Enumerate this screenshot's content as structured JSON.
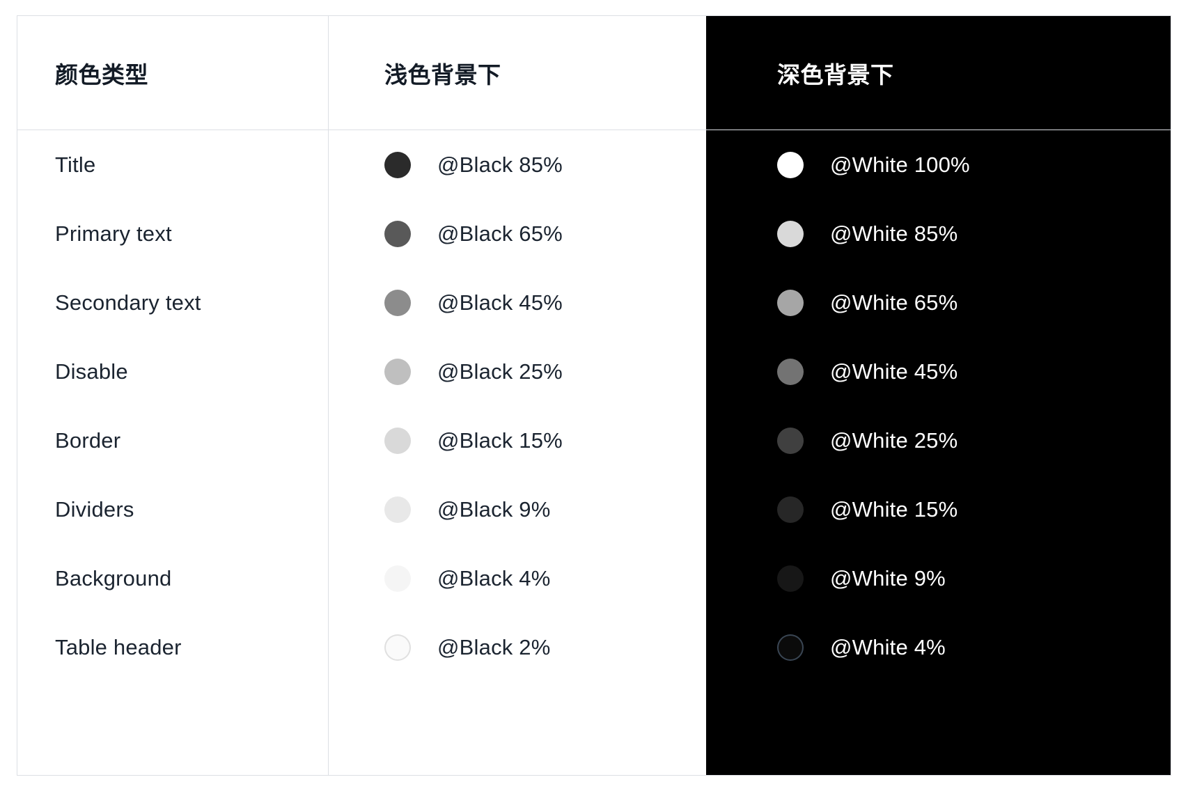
{
  "table": {
    "headers": [
      {
        "label": "颜色类型"
      },
      {
        "label": "浅色背景下"
      },
      {
        "label": "深色背景下"
      }
    ],
    "rows": [
      {
        "name": "Title",
        "light": {
          "token": "@Black 85%",
          "color": "#2b2b2b",
          "ring": false
        },
        "dark": {
          "token": "@White 100%",
          "color": "#ffffff",
          "ring": false
        }
      },
      {
        "name": "Primary text",
        "light": {
          "token": "@Black 65%",
          "color": "#595959",
          "ring": false
        },
        "dark": {
          "token": "@White 85%",
          "color": "#d9d9d9",
          "ring": false
        }
      },
      {
        "name": "Secondary text",
        "light": {
          "token": "@Black 45%",
          "color": "#8c8c8c",
          "ring": false
        },
        "dark": {
          "token": "@White 65%",
          "color": "#a6a6a6",
          "ring": false
        }
      },
      {
        "name": "Disable",
        "light": {
          "token": "@Black 25%",
          "color": "#bfbfbf",
          "ring": false
        },
        "dark": {
          "token": "@White 45%",
          "color": "#737373",
          "ring": false
        }
      },
      {
        "name": "Border",
        "light": {
          "token": "@Black 15%",
          "color": "#d9d9d9",
          "ring": false
        },
        "dark": {
          "token": "@White 25%",
          "color": "#404040",
          "ring": false
        }
      },
      {
        "name": "Dividers",
        "light": {
          "token": "@Black 9%",
          "color": "#e8e8e8",
          "ring": false
        },
        "dark": {
          "token": "@White 15%",
          "color": "#272727",
          "ring": false
        }
      },
      {
        "name": "Background",
        "light": {
          "token": "@Black 4%",
          "color": "#f5f5f5",
          "ring": false
        },
        "dark": {
          "token": "@White 9%",
          "color": "#171717",
          "ring": false
        }
      },
      {
        "name": "Table header",
        "light": {
          "token": "@Black 2%",
          "color": "#fafafa",
          "ring": true,
          "ring_color": "#e0e0e0"
        },
        "dark": {
          "token": "@White 4%",
          "color": "#0b0b0b",
          "ring": true,
          "ring_color": "#3a4654"
        }
      }
    ]
  },
  "style": {
    "frame_border": "#dcdfe4",
    "dark_panel_bg": "#000000",
    "light_panel_bg": "#ffffff",
    "light_text": "#1b2430",
    "dark_text": "#ffffff"
  }
}
